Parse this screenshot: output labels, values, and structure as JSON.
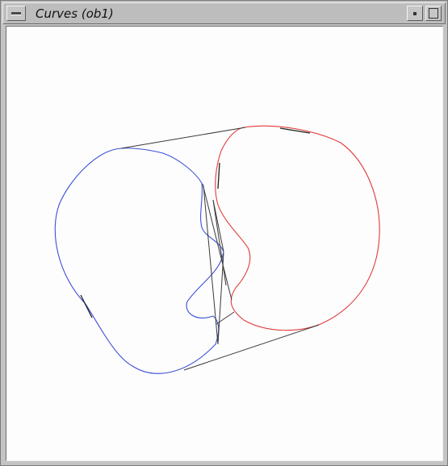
{
  "window": {
    "title": "Curves (ob1)"
  },
  "colors": {
    "blue_curve": "#3b4fd8",
    "red_curve": "#e23a3a",
    "tangent_lines": "#3a3a3a"
  },
  "icons": {
    "menu": "window-menu-icon",
    "minimize": "minimize-icon",
    "maximize": "maximize-icon"
  }
}
